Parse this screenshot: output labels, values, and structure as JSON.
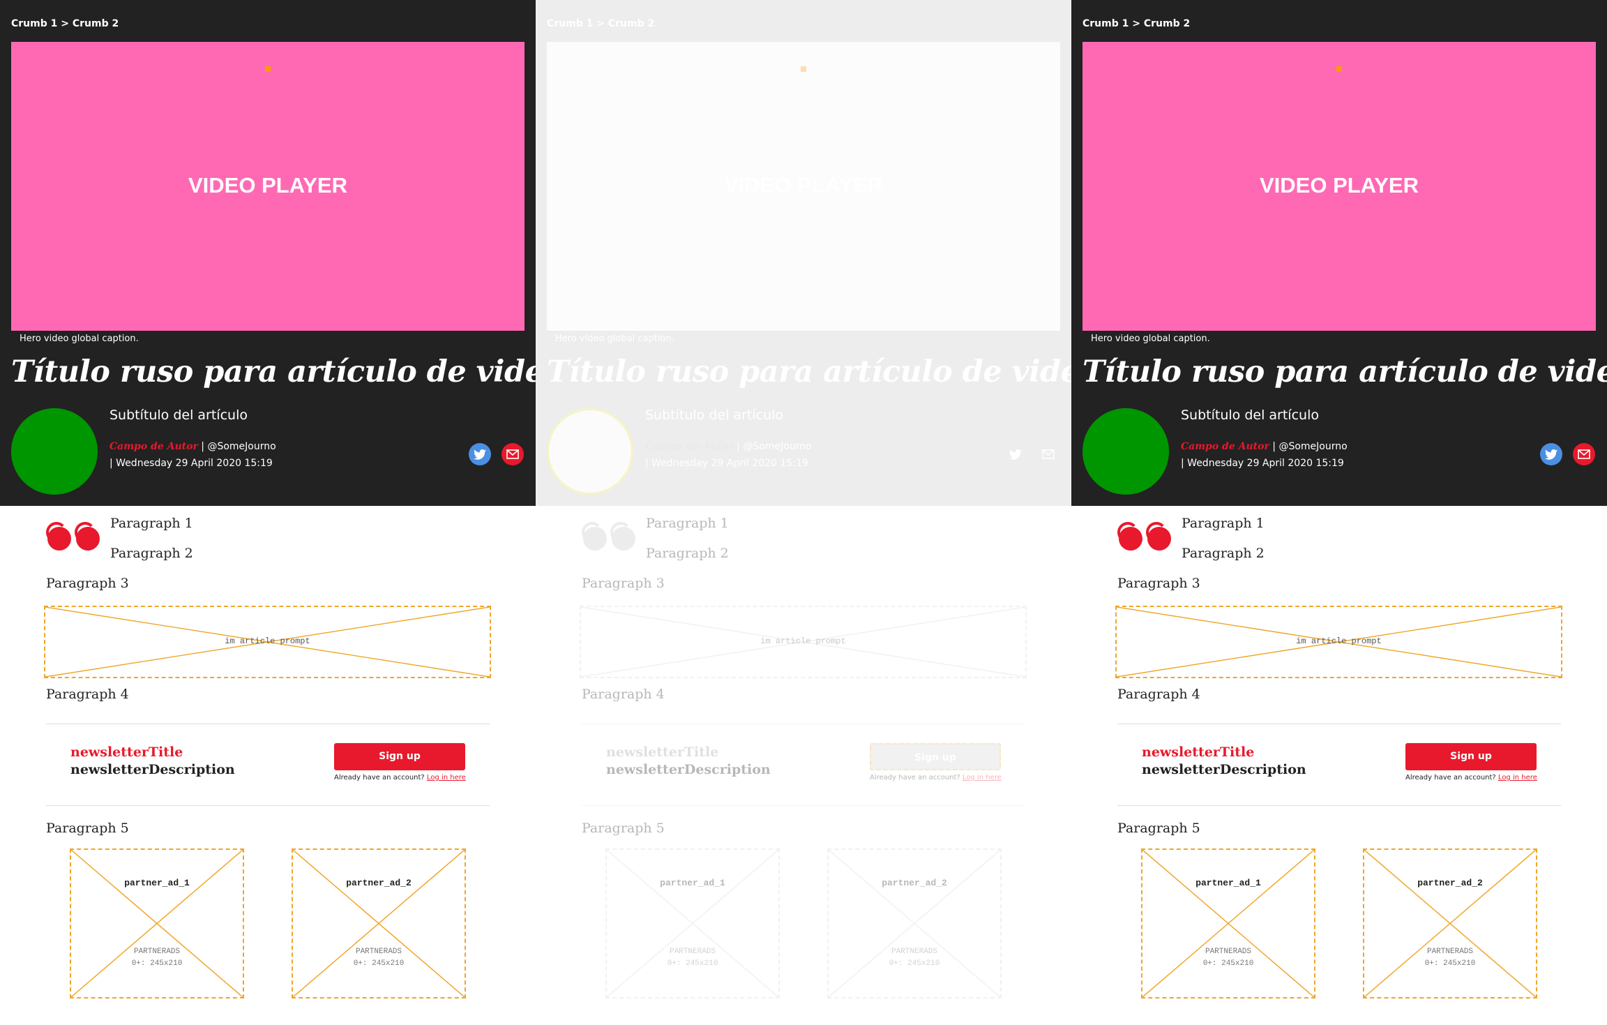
{
  "breadcrumb": "Crumb 1 > Crumb 2",
  "video": {
    "label": "VIDEO PLAYER",
    "caption": "Hero video global caption.",
    "color": "#ff69b4"
  },
  "article": {
    "title": "Título ruso para artículo de video",
    "subtitle": "Subtítulo del artículo",
    "author": "Campo de Autor",
    "handle": " | @SomeJourno",
    "date": "| Wednesday 29 April 2020 15:19"
  },
  "social": {
    "twitter_icon": "twitter-icon",
    "email_icon": "email-icon"
  },
  "paragraphs": [
    "Paragraph 1",
    "Paragraph 2",
    "Paragraph 3",
    "Paragraph 4",
    "Paragraph 5"
  ],
  "prompt": {
    "label": "im article prompt"
  },
  "newsletter": {
    "title": "newsletterTitle",
    "description": "newsletterDescription",
    "signup_label": "Sign up",
    "account_text": "Already have an account? ",
    "login_label": "Log in here"
  },
  "ads": [
    {
      "name": "partner_ad_1",
      "meta1": "PARTNERADS",
      "meta2": "0+: 245x210"
    },
    {
      "name": "partner_ad_2",
      "meta1": "PARTNERADS",
      "meta2": "0+: 245x210"
    }
  ],
  "colors": {
    "accent": "#e8192c",
    "hero_bg": "#222222",
    "avatar": "#009600",
    "twitter": "#4a90e2",
    "placeholder_outline": "#f0a628"
  }
}
